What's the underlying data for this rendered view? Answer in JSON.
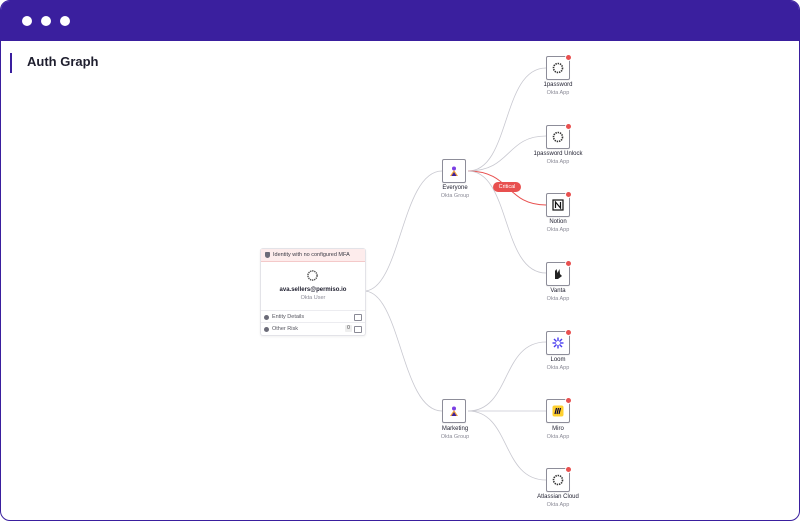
{
  "page": {
    "title": "Auth Graph"
  },
  "identity_card": {
    "warning": "Identity with no configured MFA",
    "email": "ava.sellers@permiso.io",
    "type": "Okta User",
    "rows": [
      {
        "label": "Entity Details"
      },
      {
        "label": "Other Risk",
        "count": "0"
      }
    ]
  },
  "groups": [
    {
      "name": "Everyone",
      "type": "Okta Group",
      "icon": "group-icon"
    },
    {
      "name": "Marketing",
      "type": "Okta Group",
      "icon": "group-icon"
    }
  ],
  "apps": [
    {
      "name": "1password",
      "type": "Okta App",
      "icon": "gear-icon"
    },
    {
      "name": "1password Unlock",
      "type": "Okta App",
      "icon": "gear-icon"
    },
    {
      "name": "Notion",
      "type": "Okta App",
      "icon": "notion-icon"
    },
    {
      "name": "Vanta",
      "type": "Okta App",
      "icon": "vanta-icon"
    },
    {
      "name": "Loom",
      "type": "Okta App",
      "icon": "loom-icon"
    },
    {
      "name": "Miro",
      "type": "Okta App",
      "icon": "miro-icon"
    },
    {
      "name": "Atlassian Cloud",
      "type": "Okta App",
      "icon": "gear-icon"
    }
  ],
  "edge_labels": {
    "critical": "Critical"
  },
  "colors": {
    "brand": "#3a1f9e",
    "alert": "#e8504f",
    "edge": "#c8c8d0"
  }
}
